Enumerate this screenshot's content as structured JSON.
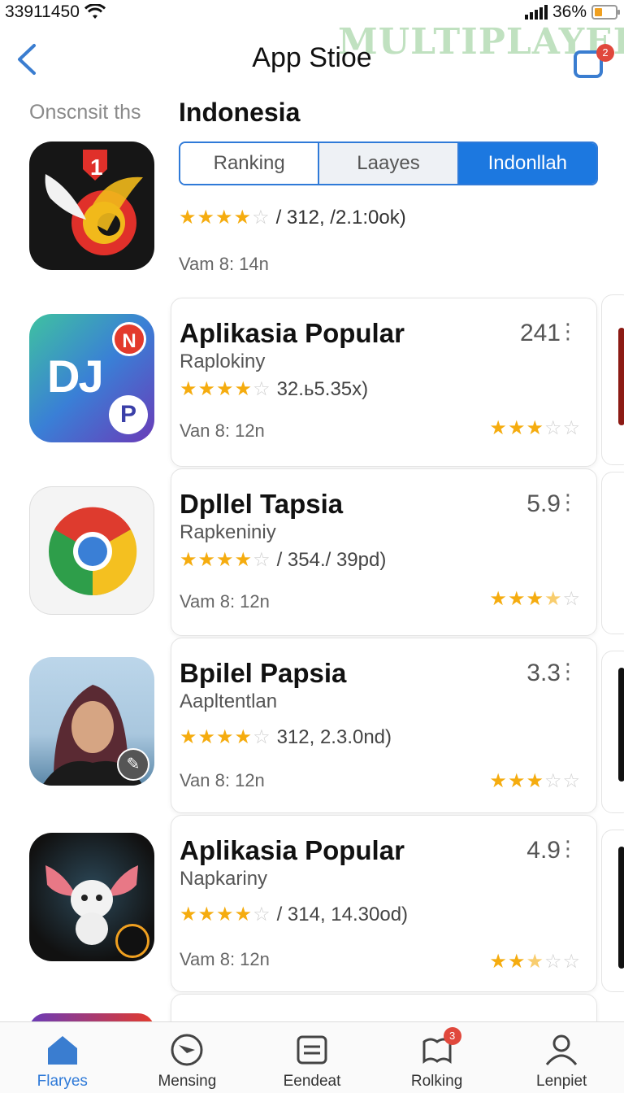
{
  "status_bar": {
    "time": "33911450",
    "signal": "36%"
  },
  "watermark": "MULTIPLAYER",
  "nav": {
    "title": "App Stioe",
    "badge": "2"
  },
  "side_label": "Onscnsit ths",
  "region_title": "Indonesia",
  "segments": [
    "Ranking",
    "Laayes",
    "Indonllah"
  ],
  "featured": {
    "badge": "1",
    "rating_text": "/ 312, /2.1:0ok)",
    "time": "Vam 8: 14n",
    "stars": [
      1,
      1,
      1,
      1,
      0
    ]
  },
  "apps": [
    {
      "title": "Aplikasia Popular",
      "subtitle": "Raplokiny",
      "score": "241",
      "rating_text": "32.ь5.35x)",
      "time": "Van 8: 12n",
      "stars_inline": [
        1,
        1,
        1,
        1,
        0
      ],
      "stars_right": [
        1,
        1,
        1,
        0,
        0
      ],
      "icon_text": "DJ",
      "icon_badge_n": "N",
      "icon_badge_p": "P"
    },
    {
      "title": "Dpllel Tapsia",
      "subtitle": "Rapkeniniy",
      "score": "5.9",
      "rating_text": "/ 354./ 39pd)",
      "time": "Vam 8: 12n",
      "stars_inline": [
        1,
        1,
        1,
        1,
        0
      ],
      "stars_right": [
        1,
        1,
        1,
        0.5,
        0
      ]
    },
    {
      "title": "Bpilel Papsia",
      "subtitle": "Aapltentlan",
      "score": "3.3",
      "rating_text": "312, 2.3.0nd)",
      "time": "Van 8: 12n",
      "stars_inline": [
        1,
        1,
        1,
        1,
        0
      ],
      "stars_right": [
        1,
        1,
        1,
        0,
        0
      ]
    },
    {
      "title": "Aplikasia Popular",
      "subtitle": "Napkariny",
      "score": "4.9",
      "rating_text": "/ 314, 14.30od)",
      "time": "Vam 8: 12n",
      "stars_inline": [
        1,
        1,
        1,
        1,
        0
      ],
      "stars_right": [
        1,
        1,
        0.5,
        0,
        0
      ]
    }
  ],
  "tabs": [
    {
      "label": "Flaryes",
      "icon": "home-icon",
      "active": true
    },
    {
      "label": "Mensing",
      "icon": "compass-icon"
    },
    {
      "label": "Eendeat",
      "icon": "document-icon"
    },
    {
      "label": "Rolking",
      "icon": "map-icon",
      "badge": "3"
    },
    {
      "label": "Lenpiet",
      "icon": "profile-icon"
    }
  ],
  "colors": {
    "accent": "#1c78e0",
    "star": "#f5ac0f",
    "badge": "#e0483c"
  }
}
